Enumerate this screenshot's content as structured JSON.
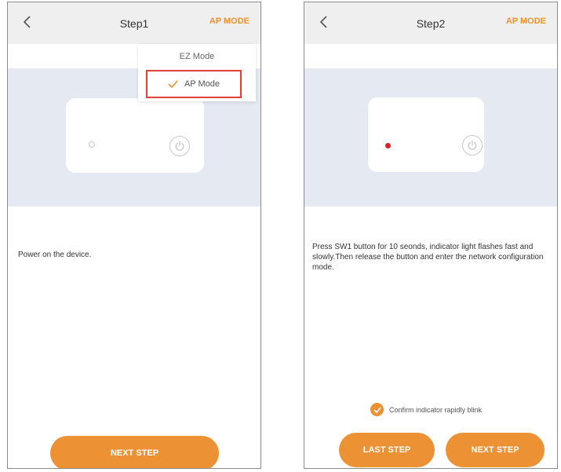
{
  "screens": [
    {
      "title": "Step1",
      "mode_link": "AP MODE",
      "dropdown": {
        "ez_mode": "EZ Mode",
        "ap_mode": "AP Mode"
      },
      "instruction": "Power on the device.",
      "next_button": "NEXT STEP",
      "led_state": "off"
    },
    {
      "title": "Step2",
      "mode_link": "AP MODE",
      "instruction": "Press SW1 button for 10 seonds, indicator light flashes fast and slowly.Then release the button and enter the network configuration mode.",
      "confirm_label": "Confirm indicator rapidly blink",
      "confirm_checked": true,
      "last_button": "LAST STEP",
      "next_button": "NEXT STEP",
      "led_state": "red"
    }
  ],
  "icons": {
    "back": "chevron-left-icon",
    "power": "power-icon",
    "check": "check-icon"
  },
  "colors": {
    "accent": "#ec9235",
    "mode_link": "#f0922b",
    "highlight_box": "#e0403a",
    "led_red": "#e02020",
    "illustration_bg": "#e5e9f1",
    "topbar_bg": "#efefef"
  }
}
